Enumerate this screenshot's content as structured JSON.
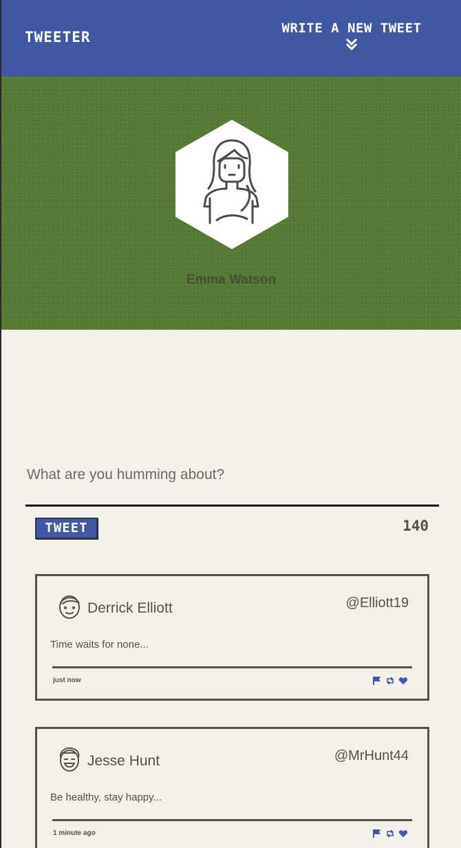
{
  "nav": {
    "brand": "Tweeter",
    "compose_toggle": "Write a new tweet",
    "chevron_icon": "double-chevron-down-icon"
  },
  "profile": {
    "name": "Emma Watson",
    "avatar_icon": "woman-avatar-icon"
  },
  "composer": {
    "placeholder": "What are you humming about?",
    "value": "",
    "submit_label": "Tweet",
    "char_count": "140"
  },
  "tweets": [
    {
      "author": "Derrick Elliott",
      "handle": "@Elliott19",
      "text": "Time waits for none...",
      "time": "just now",
      "avatar_icon": "man-face-avatar-icon"
    },
    {
      "author": "Jesse Hunt",
      "handle": "@MrHunt44",
      "text": "Be healthy, stay happy...",
      "time": "1 minute ago",
      "avatar_icon": "smiling-man-avatar-icon"
    }
  ],
  "tweet_actions": [
    "flag-icon",
    "retweet-icon",
    "heart-icon"
  ],
  "colors": {
    "nav_bg": "#4257a3",
    "header_bg": "#557a33",
    "page_bg": "#f3f0ec",
    "text": "#545149",
    "accent": "#4257a3"
  }
}
